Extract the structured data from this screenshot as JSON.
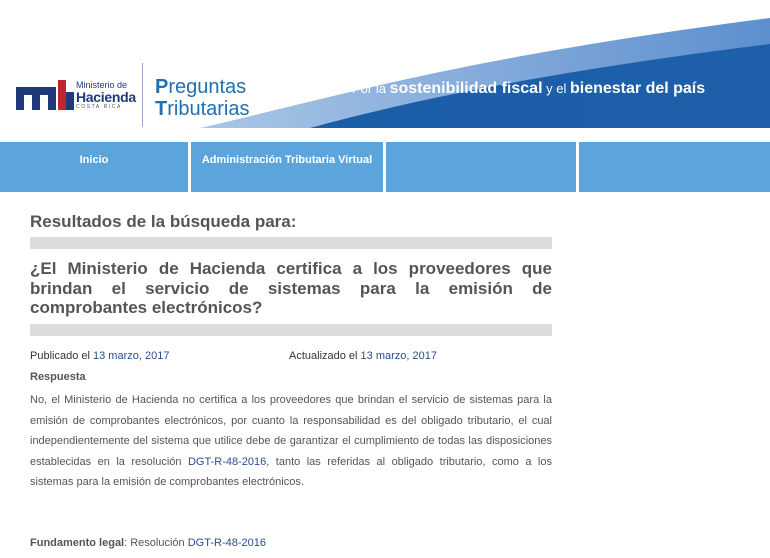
{
  "header": {
    "logo": {
      "line1": "Ministerio de",
      "line2": "Hacienda",
      "line3": "COSTA RICA"
    },
    "brand": {
      "line1_initial": "P",
      "line1_rest": "reguntas",
      "line2_initial": "T",
      "line2_rest": "ributarias"
    },
    "slogan": {
      "part1": "Por la ",
      "part2": "sostenibilidad fiscal",
      "part3": " y el ",
      "part4": "bienestar del país"
    },
    "colors": {
      "banner": "#1a5ea8",
      "brand": "#1f6fb2",
      "logo": "#1e3a78"
    }
  },
  "nav": {
    "items": [
      {
        "label": "Inicio"
      },
      {
        "label": "Administración Tributaria Virtual"
      },
      {
        "label": ""
      },
      {
        "label": ""
      }
    ],
    "color": "#5ba5dc"
  },
  "content": {
    "results_heading": "Resultados de la búsqueda para:",
    "question": "¿El Ministerio de Hacienda certifica a los proveedores que brindan el servicio de sistemas para la emisión de comprobantes electrónicos?",
    "published_label": "Publicado el ",
    "published_date": "13 marzo, 2017",
    "updated_label": "Actualizado el ",
    "updated_date": "13 marzo, 2017",
    "answer_label": "Respuesta",
    "answer_part1": "No, el Ministerio de Hacienda no certifica a los proveedores que brindan el servicio de sistemas para la emisión de comprobantes electrónicos, por cuanto la responsabilidad es del obligado tributario, el cual independientemente del sistema que utilice debe de garantizar el cumplimiento de todas las disposiciones establecidas en la resolución ",
    "answer_link": "DGT-R-48-2016",
    "answer_part2": ", tanto las referidas al obligado tributario, como a los sistemas para la emisión de comprobantes electrónicos.",
    "legal_label": "Fundamento legal",
    "legal_sep": ": Resolución ",
    "legal_link": "DGT-R-48-2016"
  }
}
